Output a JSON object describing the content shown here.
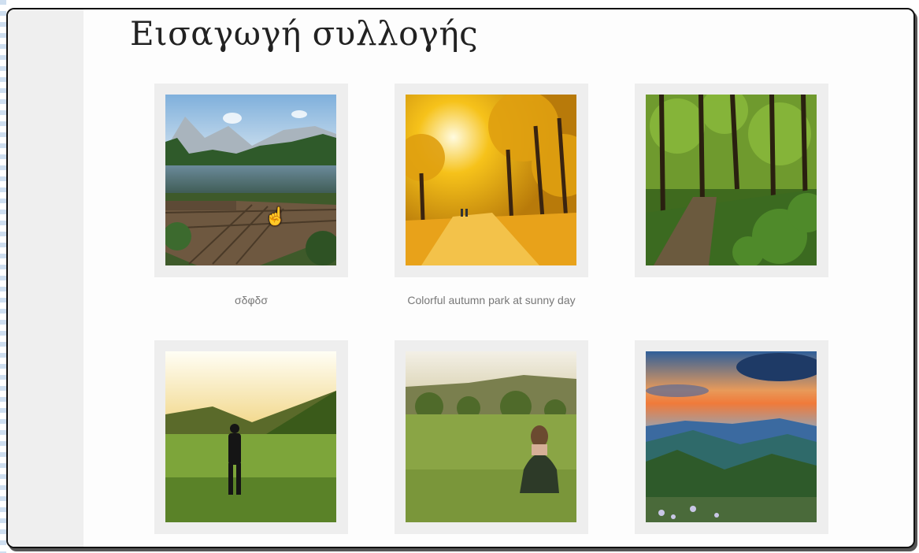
{
  "page": {
    "title": "Εισαγωγή συλλογής"
  },
  "gallery": {
    "items": [
      {
        "caption": "σδφδσ",
        "scene": "mountain-lake-dock"
      },
      {
        "caption": "Colorful autumn park at sunny day",
        "scene": "autumn-park"
      },
      {
        "caption": "",
        "scene": "forest-path"
      },
      {
        "caption": "",
        "scene": "man-walking-meadow"
      },
      {
        "caption": "",
        "scene": "woman-sitting-meadow"
      },
      {
        "caption": "",
        "scene": "mountain-sunset"
      }
    ]
  },
  "cursor": {
    "icon": "hand-pointer-icon"
  }
}
